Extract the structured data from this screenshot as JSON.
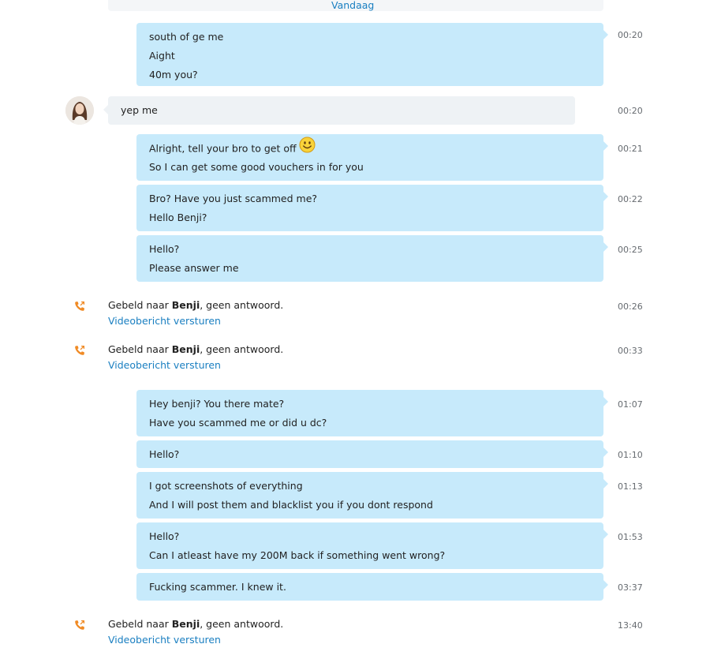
{
  "date_label": "Vandaag",
  "avatar_icon": "user-avatar",
  "call_icon": "missed-call-icon",
  "emoji_icon": "smiley-emoji",
  "colors": {
    "outgoing_bubble": "#c7eafb",
    "incoming_bubble": "#eef2f5",
    "link": "#1a7fc1",
    "call_icon": "#f08a24"
  },
  "messages": [
    {
      "lines": [
        "south of ge me",
        "Aight",
        "40m you?"
      ],
      "time": "00:20"
    },
    {
      "lines": [
        "yep me"
      ],
      "time": "00:20"
    },
    {
      "lines": [
        "Alright, tell your bro to get off",
        "So I can get some good vouchers in for you"
      ],
      "time": "00:21"
    },
    {
      "lines": [
        "Bro? Have you just scammed me?",
        "Hello Benji?"
      ],
      "time": "00:22"
    },
    {
      "lines": [
        "Hello?",
        "Please answer me"
      ],
      "time": "00:25"
    },
    {
      "lines": [
        "Hey benji? You there mate?",
        "Have you scammed me or did u dc?"
      ],
      "time": "01:07"
    },
    {
      "lines": [
        "Hello?"
      ],
      "time": "01:10"
    },
    {
      "lines": [
        "I got screenshots of everything",
        "And I will post them and blacklist you if you dont respond"
      ],
      "time": "01:13"
    },
    {
      "lines": [
        "Hello?",
        "Can I atleast have my 200M back if something went wrong?"
      ],
      "time": "01:53"
    },
    {
      "lines": [
        "Fucking scammer. I knew it."
      ],
      "time": "03:37"
    }
  ],
  "calls": [
    {
      "prefix": "Gebeld naar ",
      "name": "Benji",
      "suffix": ", geen antwoord.",
      "link": "Videobericht versturen",
      "time": "00:26"
    },
    {
      "prefix": "Gebeld naar ",
      "name": "Benji",
      "suffix": ", geen antwoord.",
      "link": "Videobericht versturen",
      "time": "00:33"
    },
    {
      "prefix": "Gebeld naar ",
      "name": "Benji",
      "suffix": ", geen antwoord.",
      "link": "Videobericht versturen",
      "time": "13:40"
    }
  ]
}
